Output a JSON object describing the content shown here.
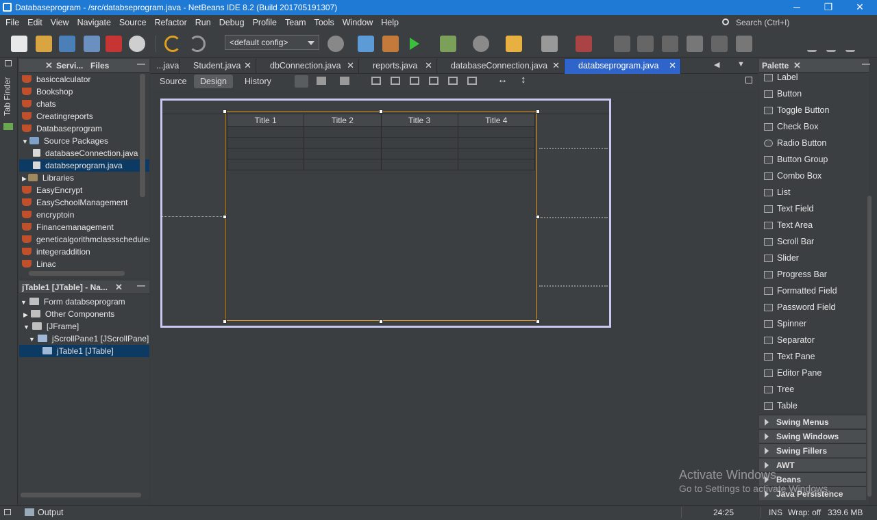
{
  "window": {
    "title": "Databaseprogram - /src/databseprogram.java - NetBeans IDE 8.2 (Build 201705191307)",
    "minimize": "─",
    "restore": "❐",
    "close": "✕"
  },
  "menu": [
    "File",
    "Edit",
    "View",
    "Navigate",
    "Source",
    "Refactor",
    "Run",
    "Debug",
    "Profile",
    "Team",
    "Tools",
    "Window",
    "Help"
  ],
  "search": {
    "placeholder": "Search (Ctrl+I)"
  },
  "toolbar": {
    "config": "<default config>"
  },
  "leftstrip": {
    "label": "Tab Finder"
  },
  "projects": {
    "tabs": [
      "",
      "Servi...",
      "Files"
    ],
    "items": [
      {
        "label": "basiccalculator",
        "indent": 0,
        "kind": "project"
      },
      {
        "label": "Bookshop",
        "indent": 0,
        "kind": "project"
      },
      {
        "label": "chats",
        "indent": 0,
        "kind": "project"
      },
      {
        "label": "Creatingreports",
        "indent": 0,
        "kind": "project"
      },
      {
        "label": "Databaseprogram",
        "indent": 0,
        "kind": "project"
      },
      {
        "label": "Source Packages",
        "indent": 1,
        "kind": "folder"
      },
      {
        "label": "databaseConnection.java",
        "indent": 2,
        "kind": "file"
      },
      {
        "label": "databseprogram.java",
        "indent": 2,
        "kind": "file",
        "selected": true
      },
      {
        "label": "Libraries",
        "indent": 1,
        "kind": "folder"
      },
      {
        "label": "EasyEncrypt",
        "indent": 0,
        "kind": "project"
      },
      {
        "label": "EasySchoolManagement",
        "indent": 0,
        "kind": "project"
      },
      {
        "label": "encryptoin",
        "indent": 0,
        "kind": "project"
      },
      {
        "label": "Financemanagement",
        "indent": 0,
        "kind": "project"
      },
      {
        "label": "geneticalgorithmclassscheduler",
        "indent": 0,
        "kind": "project"
      },
      {
        "label": "integeraddition",
        "indent": 0,
        "kind": "project"
      },
      {
        "label": "Linac",
        "indent": 0,
        "kind": "project"
      }
    ]
  },
  "navigator": {
    "title": "jTable1 [JTable] - Na...",
    "items": [
      {
        "label": "Form databseprogram",
        "indent": 0
      },
      {
        "label": "Other Components",
        "indent": 1
      },
      {
        "label": "[JFrame]",
        "indent": 1
      },
      {
        "label": "jScrollPane1 [JScrollPane]",
        "indent": 2
      },
      {
        "label": "jTable1 [JTable]",
        "indent": 3,
        "selected": true
      }
    ]
  },
  "editor": {
    "tabs": [
      "...java",
      "Student.java",
      "dbConnection.java",
      "reports.java",
      "databaseConnection.java",
      "databseprogram.java"
    ],
    "views": [
      "Source",
      "Design",
      "History"
    ],
    "table": {
      "headers": [
        "Title 1",
        "Title 2",
        "Title 3",
        "Title 4"
      ],
      "rows": 4
    }
  },
  "palette": {
    "title": "Palette",
    "items": [
      "Label",
      "Button",
      "Toggle Button",
      "Check Box",
      "Radio Button",
      "Button Group",
      "Combo Box",
      "List",
      "Text Field",
      "Text Area",
      "Scroll Bar",
      "Slider",
      "Progress Bar",
      "Formatted Field",
      "Password Field",
      "Spinner",
      "Separator",
      "Text Pane",
      "Editor Pane",
      "Tree",
      "Table"
    ],
    "categories": [
      "Swing Menus",
      "Swing Windows",
      "Swing Fillers",
      "AWT",
      "Beans",
      "Java Persistence"
    ]
  },
  "status": {
    "output": "Output",
    "position": "24:25",
    "mode": "INS",
    "wrap": "Wrap: off",
    "memory": "339.6 MB"
  },
  "watermark": {
    "line1": "Activate Windows",
    "line2": "Go to Settings to activate Windows."
  }
}
